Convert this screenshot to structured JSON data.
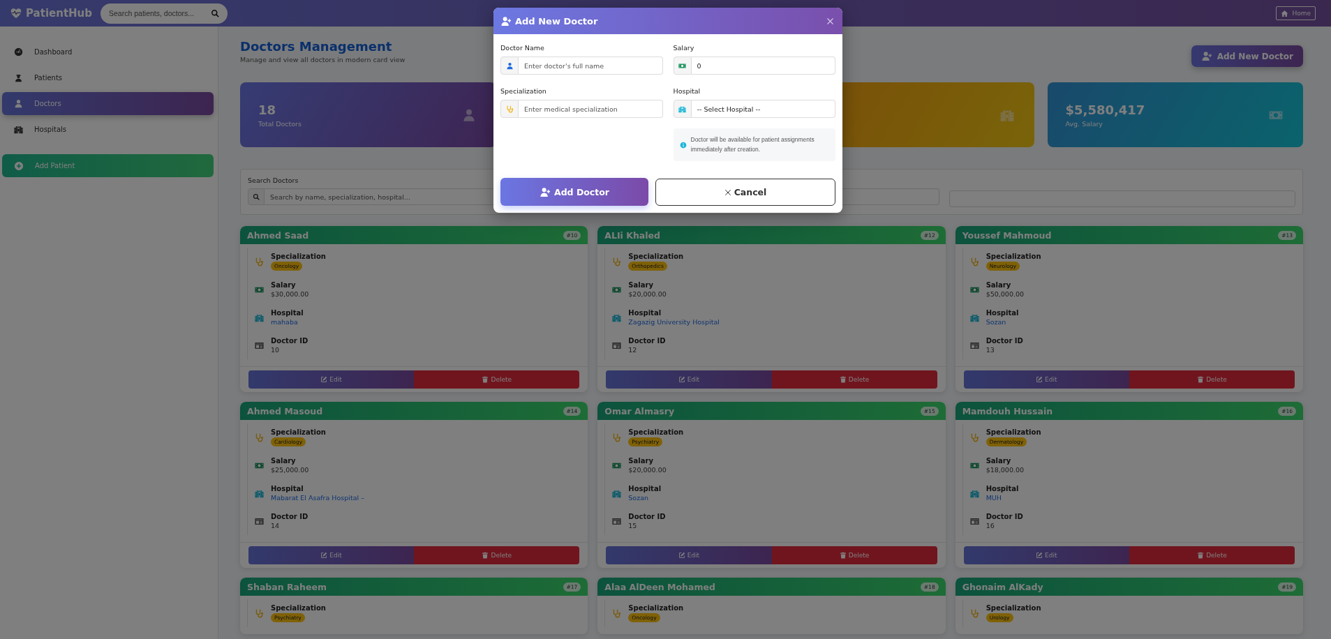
{
  "topbar": {
    "brand": "PatientHub",
    "search": {
      "placeholder": "Search patients, doctors..."
    },
    "home": "Home"
  },
  "sidebar": {
    "items": [
      {
        "label": "Dashboard",
        "selected": false
      },
      {
        "label": "Patients",
        "selected": false
      },
      {
        "label": "Doctors",
        "selected": true
      },
      {
        "label": "Hospitals",
        "selected": false
      }
    ],
    "action": "Add Patient"
  },
  "page": {
    "title": "Doctors Management",
    "subtitle": "Manage and view all doctors in modern card view",
    "add_button": "Add New Doctor"
  },
  "stats": [
    {
      "kind": "doctors",
      "value": "18",
      "label": "Total Doctors"
    },
    {
      "kind": "hospitals"
    },
    {
      "kind": "salary",
      "value": "$5,580,417",
      "label": "Avg. Salary"
    }
  ],
  "filters": {
    "search_label": "Search Doctors",
    "search_placeholder": "Search by name, specialization, hospital..."
  },
  "doctors": [
    {
      "name": "Ahmed Saad",
      "number": "#10",
      "fields": [
        {
          "kind": "specialization",
          "label": "Specialization",
          "value": "Oncology"
        },
        {
          "kind": "salary",
          "label": "Salary",
          "value": "$30,000.00"
        },
        {
          "kind": "hospital",
          "label": "Hospital",
          "value": "mahaba"
        },
        {
          "kind": "id",
          "label": "Doctor ID",
          "value": "10"
        }
      ],
      "actions": [
        {
          "kind": "edit",
          "label": "Edit"
        },
        {
          "kind": "delete",
          "label": "Delete"
        }
      ]
    },
    {
      "name": "ALIi Khaled",
      "number": "#12",
      "fields": [
        {
          "kind": "specialization",
          "label": "Specialization",
          "value": "Orthopedics"
        },
        {
          "kind": "salary",
          "label": "Salary",
          "value": "$20,000.00"
        },
        {
          "kind": "hospital",
          "label": "Hospital",
          "value": "Zagazig University Hospital"
        },
        {
          "kind": "id",
          "label": "Doctor ID",
          "value": "12"
        }
      ],
      "actions": [
        {
          "kind": "edit",
          "label": "Edit"
        },
        {
          "kind": "delete",
          "label": "Delete"
        }
      ]
    },
    {
      "name": "Youssef Mahmoud",
      "number": "#13",
      "fields": [
        {
          "kind": "specialization",
          "label": "Specialization",
          "value": "Neurology"
        },
        {
          "kind": "salary",
          "label": "Salary",
          "value": "$50,000.00"
        },
        {
          "kind": "hospital",
          "label": "Hospital",
          "value": "Sozan"
        },
        {
          "kind": "id",
          "label": "Doctor ID",
          "value": "13"
        }
      ],
      "actions": [
        {
          "kind": "edit",
          "label": "Edit"
        },
        {
          "kind": "delete",
          "label": "Delete"
        }
      ]
    },
    {
      "name": "Ahmed Masoud",
      "number": "#14",
      "fields": [
        {
          "kind": "specialization",
          "label": "Specialization",
          "value": "Cardiology"
        },
        {
          "kind": "salary",
          "label": "Salary",
          "value": "$25,000.00"
        },
        {
          "kind": "hospital",
          "label": "Hospital",
          "value": "Mabarat El Asafra Hospital –"
        },
        {
          "kind": "id",
          "label": "Doctor ID",
          "value": "14"
        }
      ],
      "actions": [
        {
          "kind": "edit",
          "label": "Edit"
        },
        {
          "kind": "delete",
          "label": "Delete"
        }
      ]
    },
    {
      "name": "Omar Almasry",
      "number": "#15",
      "fields": [
        {
          "kind": "specialization",
          "label": "Specialization",
          "value": "Psychiatry"
        },
        {
          "kind": "salary",
          "label": "Salary",
          "value": "$20,000.00"
        },
        {
          "kind": "hospital",
          "label": "Hospital",
          "value": "Sozan"
        },
        {
          "kind": "id",
          "label": "Doctor ID",
          "value": "15"
        }
      ],
      "actions": [
        {
          "kind": "edit",
          "label": "Edit"
        },
        {
          "kind": "delete",
          "label": "Delete"
        }
      ]
    },
    {
      "name": "Mamdouh Hussain",
      "number": "#16",
      "fields": [
        {
          "kind": "specialization",
          "label": "Specialization",
          "value": "Dermatology"
        },
        {
          "kind": "salary",
          "label": "Salary",
          "value": "$18,000.00"
        },
        {
          "kind": "hospital",
          "label": "Hospital",
          "value": "MUH"
        },
        {
          "kind": "id",
          "label": "Doctor ID",
          "value": "16"
        }
      ],
      "actions": [
        {
          "kind": "edit",
          "label": "Edit"
        },
        {
          "kind": "delete",
          "label": "Delete"
        }
      ]
    },
    {
      "name": "Shaban Raheem",
      "number": "#17",
      "fields": [
        {
          "kind": "specialization",
          "label": "Specialization",
          "value": "Psychiatry"
        }
      ]
    },
    {
      "name": "Alaa AlDeen Mohamed",
      "number": "#18",
      "fields": [
        {
          "kind": "specialization",
          "label": "Specialization",
          "value": "Oncology"
        }
      ]
    },
    {
      "name": "Ghonaim AlKady",
      "number": "#19",
      "fields": [
        {
          "kind": "specialization",
          "label": "Specialization",
          "value": "Urology"
        }
      ]
    }
  ],
  "modal": {
    "title": "Add New Doctor",
    "fields": [
      {
        "label": "Doctor Name",
        "placeholder": "Enter doctor's full name"
      },
      {
        "label": "Salary",
        "value": "0"
      },
      {
        "label": "Specialization",
        "placeholder": "Enter medical specialization"
      },
      {
        "label": "Hospital",
        "value": "-- Select Hospital --"
      }
    ],
    "note": "Doctor will be available for patient assignments immediately after creation.",
    "buttons": [
      {
        "kind": "primary",
        "label": "Add Doctor"
      },
      {
        "kind": "cancel",
        "label": "Cancel"
      }
    ]
  }
}
